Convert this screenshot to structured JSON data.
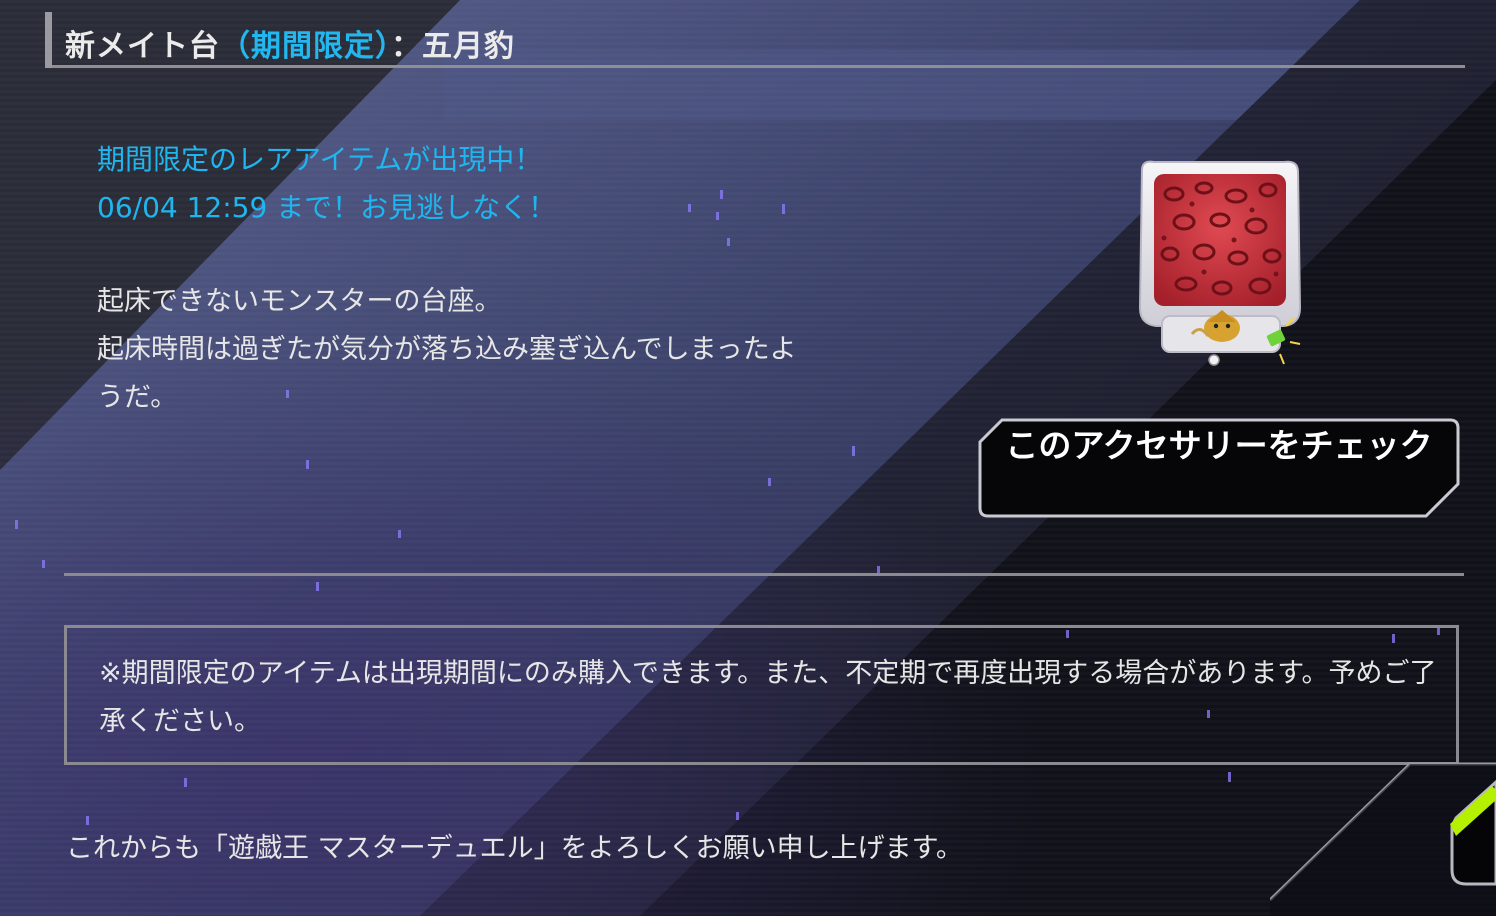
{
  "header": {
    "title_prefix": "新メイト台",
    "title_highlight": "（期間限定）",
    "title_suffix": "：五月豹"
  },
  "limited_notice": {
    "line1": "期間限定のレアアイテムが出現中！",
    "line2": "06/04 12:59 まで！お見逃しなく！"
  },
  "description": {
    "line1": "起床できないモンスターの台座。",
    "line2": "起床時間は過ぎたが気分が落ち込み塞ぎ込んでしまったよ",
    "line3": "うだ。"
  },
  "item": {
    "icon": "leopard-print-mate-stand-icon",
    "colors": {
      "cushion_red": "#c8323c",
      "frame_white": "#ecebf0"
    }
  },
  "buttons": {
    "check_accessory_label": "このアクセサリーをチェック"
  },
  "notice_box": {
    "text": "※期間限定のアイテムは出現期間にのみ購入できます。また、不定期で再度出現する場合があります。予めご了承ください。"
  },
  "footer": {
    "closing": "これからも「遊戯王 マスターデュエル」をよろしくお願い申し上げます。"
  },
  "theme": {
    "accent_blue": "#1fb6f0",
    "accent_green": "#b4f000",
    "background": "#0c0d14"
  }
}
